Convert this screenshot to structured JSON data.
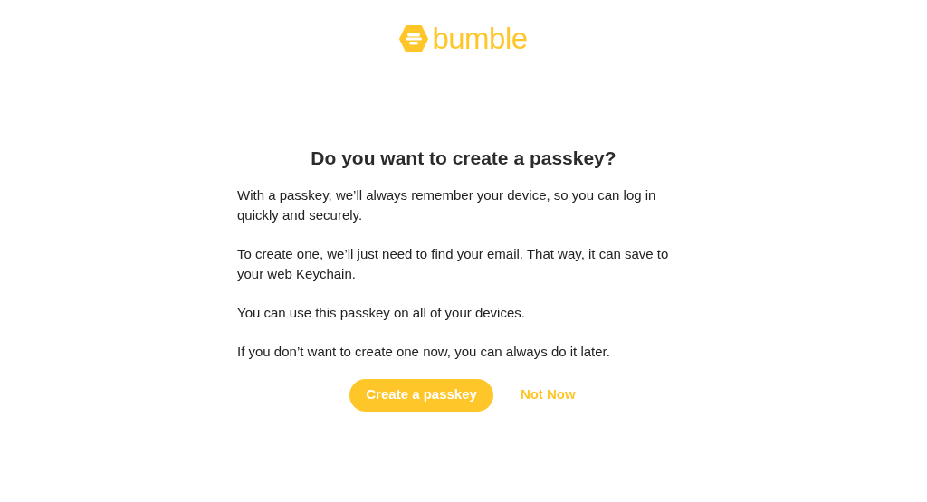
{
  "logo": {
    "wordmark": "bumble"
  },
  "dialog": {
    "title": "Do you want to create a passkey?",
    "paragraphs": [
      "With a passkey, we’ll always remember your device, so you can log in quickly and securely.",
      "To create one, we’ll just need to find your email. That way, it can save to your web Keychain.",
      "You can use this passkey on all of your devices.",
      "If you don’t want to create one now, you can always do it later."
    ],
    "buttons": [
      {
        "label": "Create a passkey",
        "kind": "primary"
      },
      {
        "label": "Not Now",
        "kind": "link"
      }
    ]
  }
}
